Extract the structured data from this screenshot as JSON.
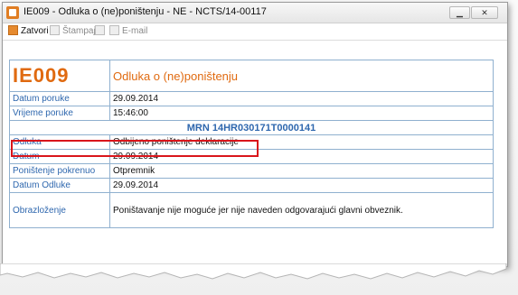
{
  "window": {
    "title": "IE009 - Odluka o (ne)poništenju - NE - NCTS/14-00117",
    "min_label": "▁",
    "close_label": "✕"
  },
  "toolbar": {
    "close_label": "Zatvori",
    "print_label": "Štampaj",
    "email_label": "E-mail"
  },
  "document": {
    "code": "IE009",
    "heading": "Odluka o (ne)poništenju",
    "rows": [
      {
        "label": "Datum poruke",
        "value": "29.09.2014"
      },
      {
        "label": "Vrijeme poruke",
        "value": "15:46:00"
      }
    ],
    "mrn": "MRN 14HR030171T0000141",
    "rows2": [
      {
        "label": "Odluka",
        "value": "Odbijeno poništenje deklaracije"
      },
      {
        "label": "Datum",
        "value": "29.09.2014"
      },
      {
        "label": "Poništenje pokrenuo",
        "value": "Otpremnik"
      },
      {
        "label": "Datum Odluke",
        "value": "29.09.2014"
      },
      {
        "label": "Obrazloženje",
        "value": "Poništavanje nije moguće jer nije naveden odgovarajući glavni obveznik."
      }
    ]
  },
  "colors": {
    "accent_orange": "#e06a10",
    "label_blue": "#2e67ae",
    "highlight_red": "#d9151b"
  }
}
